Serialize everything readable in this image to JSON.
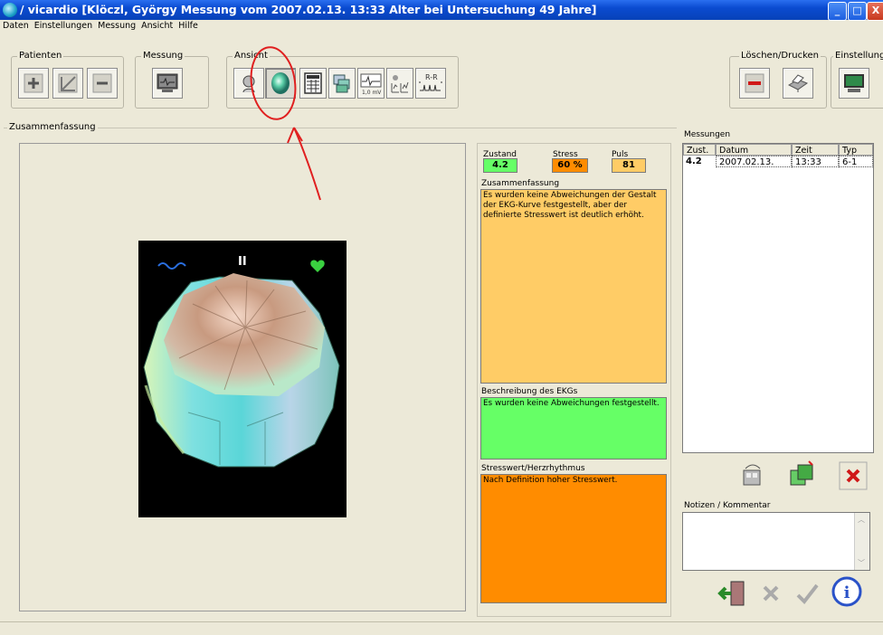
{
  "window": {
    "title": "/ vicardio [Klöczl, György Messung vom 2007.02.13. 13:33 Alter bei Untersuchung 49 Jahre]",
    "buttons": {
      "minimize": "_",
      "maximize": "□",
      "close": "X"
    }
  },
  "menu": [
    "Daten",
    "Einstellungen",
    "Messung",
    "Ansicht",
    "Hilfe"
  ],
  "toolbar": {
    "patienten_label": "Patienten",
    "messung_label": "Messung",
    "ansicht_label": "Ansicht",
    "loeschen_label": "Löschen/Drucken",
    "einstellungen_label": "Einstellungen",
    "ecg_scale_label": "1,0 mV",
    "rr_label": "R-R"
  },
  "summary": {
    "frame_label": "Zusammenfassung",
    "lead_label": "II",
    "zustand_label": "Zustand",
    "zustand_value": "4.2",
    "stress_label": "Stress",
    "stress_value": "60 %",
    "puls_label": "Puls",
    "puls_value": "81",
    "zusammenfassung_label": "Zusammenfassung",
    "zusammenfassung_text": "Es wurden keine Abweichungen der Gestalt der EKG-Kurve festgestellt, aber der definierte Stresswert ist deutlich erhöht.",
    "beschreibung_label": "Beschreibung des EKGs",
    "beschreibung_text": "Es wurden keine Abweichungen festgestellt.",
    "stresswert_label": "Stresswert/Herzrhythmus",
    "stresswert_text": "Nach Definition hoher Stresswert."
  },
  "colors": {
    "zustand_bg": "#66ff66",
    "stress_bg": "#ff8c00",
    "puls_bg": "#ffcc66",
    "zusammenfassung_bg": "#ffcc66",
    "beschreibung_bg": "#66ff66",
    "stresswert_bg": "#ff8c00",
    "annotation": "#e02020"
  },
  "measurements": {
    "label": "Messungen",
    "columns": [
      "Zust.",
      "Datum",
      "Zeit",
      "Typ"
    ],
    "rows": [
      {
        "zust": "4.2",
        "datum": "2007.02.13.",
        "zeit": "13:33",
        "typ": "6-1"
      }
    ]
  },
  "notes": {
    "label": "Notizen / Kommentar",
    "value": ""
  },
  "icons": [
    "add-patient-icon",
    "edit-patient-icon",
    "remove-patient-icon",
    "monitor-icon",
    "portrait-icon",
    "3d-heart-icon",
    "table-icon",
    "windows-icon",
    "ecg-scale-icon",
    "chart-icon",
    "rr-icon",
    "delete-icon",
    "printer-icon",
    "settings-monitor-icon",
    "door-exit-icon",
    "cancel-icon",
    "ok-icon",
    "info-icon"
  ]
}
